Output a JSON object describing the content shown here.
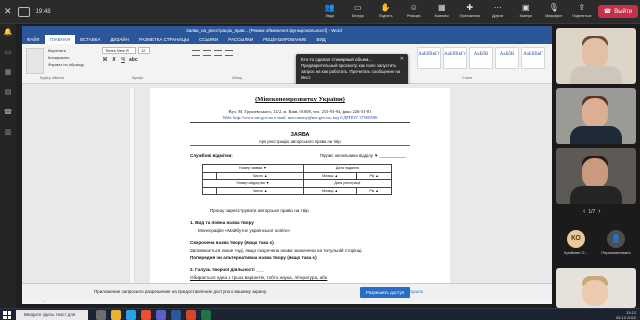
{
  "teams": {
    "timer": "19:48",
    "tools": [
      {
        "icon": "people-icon",
        "label": "Люди"
      },
      {
        "icon": "chat-icon",
        "label": "Беседа"
      },
      {
        "icon": "hand-icon",
        "label": "Поднять"
      },
      {
        "icon": "reaction-icon",
        "label": "Реакции"
      },
      {
        "icon": "rooms-icon",
        "label": "Комнаты"
      },
      {
        "icon": "apps-icon",
        "label": "Приложения"
      },
      {
        "icon": "more-icon",
        "label": "Другие"
      },
      {
        "icon": "camera-icon",
        "label": "Камера"
      },
      {
        "icon": "mic-icon",
        "label": "Микрофон"
      },
      {
        "icon": "share-icon",
        "label": "Поделиться"
      }
    ],
    "leave_label": "Выйти"
  },
  "word": {
    "title_file": "Заява_на_реєстрацію_прав... [Режим обмеженої функціональності] - Word",
    "menu": [
      "ФАЙЛ",
      "ГЛАВНАЯ",
      "ВСТАВКА",
      "ДИЗАЙН",
      "РАЗМЕТКА СТРАНИЦЫ",
      "ССЫЛКИ",
      "РАССЫЛКИ",
      "РЕЦЕНЗИРОВАНИЕ",
      "ВИД"
    ],
    "ribbon": {
      "paste": "Вставить",
      "cut": "Вырезать",
      "copy": "Копировать",
      "format_painter": "Формат по образцу",
      "font_name": "Times New R",
      "font_size": "12",
      "styles": [
        "АаБбВвГг",
        "АаБбВвГг",
        "АаБбВ",
        "АаБбВ",
        "АаБбВвГ",
        "АаБбВвГ"
      ],
      "groups": [
        "Буфер обмена",
        "Шрифт",
        "Абзац",
        "Стили"
      ]
    },
    "notification": {
      "head": "Кто-то сделал стикерный объем...",
      "body": "Предварительный просмотр как поле запустить запрос на как работать. Прочитать сообщение на Инст."
    },
    "doc": {
      "heading": "(Мінекономрозвитку України)",
      "address": "Вул. М. Грушевського, 12/2, м. Київ, 01008, тел. 253-93-94, факс 226-31-81",
      "web": "Web: http://www.me.gov.ua e-mail: meconomy@me.gov.ua, код ЄДРПОУ 37508596",
      "title": "ЗАЯВА",
      "subtitle": "про реєстрацію авторського права на твір",
      "label": "Службові відмітки:",
      "right": "Підпис начальника відділу ▼ ___________",
      "table": {
        "r1": [
          "Номер заявки ▼",
          "Дата надання"
        ],
        "r2": [
          "",
          "Число ▲",
          "Місяць ▲",
          "Рік ▲"
        ],
        "r3": [
          "Номер свідоцтва ▼",
          "Дата реєстрації"
        ],
        "r4": [
          "",
          "Число ▲",
          "Місяць ▲",
          "Рік ▲"
        ]
      },
      "p1": "Прошу зареєструвати авторське право на твір",
      "p2": "1. Вид та повна назва твору",
      "p3": "Монографія «Майбутнє української освіти»",
      "p4": "Скорочена назва твору (якщо така є)",
      "p5": "Заповнюється лише тоді, якщо скорочена назва зазначена на титульній сторінці.",
      "p6": "Попередня чи альтернативна назва твору (якщо така є)",
      "p7": "2. Галузь творчої діяльності ___",
      "p8": "Обирається одна з трьох варіантів, тобто наука, література, або"
    },
    "status": "СТРАНИЦА 1 ИЗ 3   ЧИСЛО СЛОВ: 1085   УКРАИНСКИЙ"
  },
  "infobar": {
    "text": "Приложение запросило разрешение на предоставление доступа к вашему экрану.",
    "allow": "Разрешить доступ",
    "close": "Скрыть"
  },
  "participants": {
    "pager": "1/7",
    "people": [
      {
        "initials": "КО",
        "name": "Крейман О..."
      },
      {
        "initials": "",
        "name": "Переименовать"
      }
    ]
  },
  "taskbar": {
    "search": "Введите здесь текст для поиска",
    "time": "13:12",
    "date": "06.12.2022"
  },
  "colors": {
    "word_blue": "#2b579a",
    "leave_red": "#c4314b",
    "allow_blue": "#2b6cc4"
  }
}
